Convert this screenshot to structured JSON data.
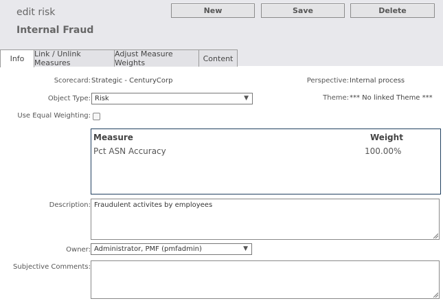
{
  "header": {
    "subtitle": "edit risk",
    "title": "Internal Fraud",
    "buttons": {
      "new": "New",
      "save": "Save",
      "delete": "Delete"
    }
  },
  "tabs": [
    {
      "label": "Info",
      "active": true
    },
    {
      "label": "Link / Unlink Measures",
      "active": false
    },
    {
      "label": "Adjust Measure Weights",
      "active": false
    },
    {
      "label": "Content",
      "active": false
    }
  ],
  "form": {
    "scorecard_label": "Scorecard:",
    "scorecard_value": "Strategic - CenturyCorp",
    "perspective_label": "Perspective:",
    "perspective_value": "Internal process",
    "object_type_label": "Object Type:",
    "object_type_value": "Risk",
    "theme_label": "Theme:",
    "theme_value": "*** No linked Theme ***",
    "equal_weighting_label": "Use Equal Weighting:",
    "equal_weighting_checked": false,
    "description_label": "Description:",
    "description_value": "Fraudulent activites by employees",
    "owner_label": "Owner:",
    "owner_value": "Administrator, PMF (pmfadmin)",
    "comments_label": "Subjective Comments:",
    "comments_value": ""
  },
  "measures_table": {
    "columns": {
      "measure": "Measure",
      "weight": "Weight"
    },
    "rows": [
      {
        "measure": "Pct ASN Accuracy",
        "weight": "100.00%"
      }
    ]
  },
  "colors": {
    "header_bg": "#e8e8ec",
    "tab_bg": "#e2e2e6",
    "grid_border": "#1f3f5f"
  }
}
